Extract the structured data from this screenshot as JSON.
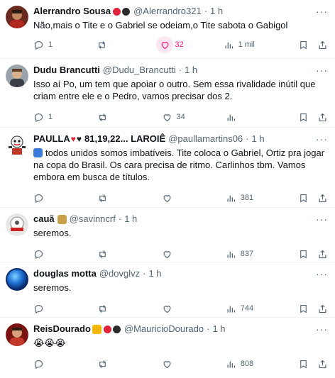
{
  "tweets": [
    {
      "name": "Alerrandro Sousa",
      "handle": "@Alerrandro321",
      "time": "1 h",
      "text": "Não,mais o Tite e o Gabriel se odeiam,o Tite sabota o Gabigol",
      "replies": "1",
      "retweets": "",
      "likes": "32",
      "views": "1 mil",
      "liked": true
    },
    {
      "name": "Dudu Brancutti",
      "handle": "@Dudu_Brancutti",
      "time": "1 h",
      "text": "Isso aí Po, um tem que apoiar o outro. Sem essa rivalidade inútil que criam entre ele e o Pedro, vamos precisar dos 2.",
      "replies": "1",
      "retweets": "",
      "likes": "34",
      "views": ""
    },
    {
      "name": "PAULLA",
      "name_suffix": "81,19,22... LAROIÊ",
      "handle": "@paullamartins06",
      "time": "1 h",
      "text": "todos unidos somos imbatíveis. Tite coloca o Gabriel, Ortiz pra jogar na copa do Brasil. Os cara precisa de ritmo. Carlinhos tbm. Vamos embora em busca de títulos.",
      "replies": "",
      "retweets": "",
      "likes": "",
      "views": "381"
    },
    {
      "name": "cauã",
      "handle": "@savinncrf",
      "time": "1 h",
      "text": "seremos.",
      "replies": "",
      "retweets": "",
      "likes": "",
      "views": "837"
    },
    {
      "name": "douglas motta",
      "handle": "@dovglvz",
      "time": "1 h",
      "text": "seremos.",
      "replies": "",
      "retweets": "",
      "likes": "",
      "views": "744"
    },
    {
      "name": "ReisDourado",
      "handle": "@MauricioDourado",
      "time": "1 h",
      "text": "😭😭😭",
      "replies": "",
      "retweets": "",
      "likes": "",
      "views": "808"
    }
  ],
  "colors": {
    "like": "#f91880",
    "muted": "#536471",
    "text": "#0f1419",
    "divider": "#eff3f4"
  },
  "icons": [
    "reply-icon",
    "retweet-icon",
    "like-icon",
    "views-icon",
    "bookmark-icon",
    "share-icon",
    "more-icon"
  ]
}
